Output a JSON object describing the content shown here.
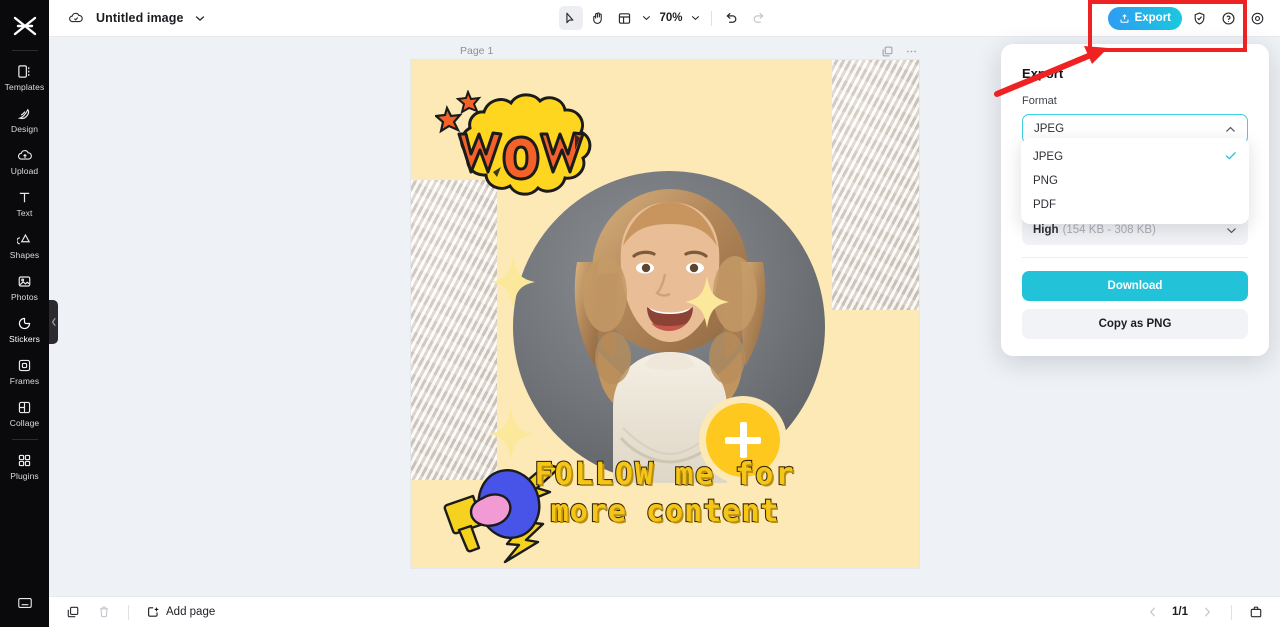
{
  "app": {
    "name": "CapCut-style design editor"
  },
  "sidebar": {
    "logo_icon": "capcut-logo-icon",
    "items": [
      {
        "id": "templates",
        "label": "Templates",
        "icon": "templates-icon"
      },
      {
        "id": "design",
        "label": "Design",
        "icon": "design-icon"
      },
      {
        "id": "upload",
        "label": "Upload",
        "icon": "upload-cloud-icon"
      },
      {
        "id": "text",
        "label": "Text",
        "icon": "text-icon"
      },
      {
        "id": "shapes",
        "label": "Shapes",
        "icon": "shapes-icon"
      },
      {
        "id": "photos",
        "label": "Photos",
        "icon": "photos-icon"
      },
      {
        "id": "stickers",
        "label": "Stickers",
        "icon": "stickers-icon"
      },
      {
        "id": "frames",
        "label": "Frames",
        "icon": "frames-icon"
      },
      {
        "id": "collage",
        "label": "Collage",
        "icon": "collage-icon"
      },
      {
        "id": "plugins",
        "label": "Plugins",
        "icon": "plugins-icon"
      }
    ],
    "bottom_icon": "workspace-icon",
    "collapse_handle_icon": "chevron-left-icon"
  },
  "topbar": {
    "cloud_icon": "cloud-saved-icon",
    "project_title": "Untitled image",
    "title_chevron_icon": "chevron-down-icon",
    "tools": [
      {
        "id": "select",
        "icon": "cursor-arrow-icon",
        "selected": true
      },
      {
        "id": "hand",
        "icon": "hand-icon",
        "selected": false
      },
      {
        "id": "layout",
        "icon": "layout-icon",
        "selected": false
      }
    ],
    "layout_chevron_icon": "chevron-down-icon",
    "zoom_level": "70%",
    "zoom_chevron_icon": "chevron-down-icon",
    "undo_icon": "undo-icon",
    "redo_icon": "redo-icon",
    "export_label": "Export",
    "export_icon": "export-upload-icon",
    "shield_icon": "shield-check-icon",
    "help_icon": "question-circle-icon",
    "settings_icon": "gear-icon"
  },
  "canvas": {
    "page_label": "Page 1",
    "duplicate_page_icon": "duplicate-icon",
    "more_icon": "more-horizontal-icon",
    "artwork": {
      "background_color": "#fce9b6",
      "wow_text": "WOW",
      "wow_bubble_color": "#ffd61f",
      "wow_letter_color": "#f4622a",
      "follow_line_1": "FOLLOW me for",
      "follow_line_2": "more content",
      "follow_text_color": "#f5c518",
      "plus_button_color": "#ffc81e",
      "plus_icon": "plus-icon",
      "megaphone_icon": "megaphone-icon",
      "lightning_icon": "lightning-bolt-icon",
      "sparkle_icon": "sparkle-icon",
      "circle_backdrop_color": "#73767a"
    }
  },
  "export_panel": {
    "title": "Export",
    "format_label": "Format",
    "format_value": "JPEG",
    "format_chevron_icon": "chevron-up-icon",
    "format_options": [
      {
        "label": "JPEG",
        "selected": true
      },
      {
        "label": "PNG",
        "selected": false
      },
      {
        "label": "PDF",
        "selected": false
      }
    ],
    "check_icon": "check-icon",
    "quality_value": "High",
    "quality_size": "(154 KB - 308 KB)",
    "quality_chevron_icon": "chevron-down-icon",
    "download_label": "Download",
    "copy_label": "Copy as PNG",
    "accent_color": "#22c3d8"
  },
  "annotation": {
    "highlight_color": "#ee2222",
    "arrow_icon": "arrow-pointer-annotation"
  },
  "bottombar": {
    "duplicate_icon": "duplicate-page-icon",
    "delete_icon": "trash-icon",
    "add_page_label": "Add page",
    "add_page_icon": "add-page-icon",
    "prev_icon": "chevron-left-icon",
    "next_icon": "chevron-right-icon",
    "page_indicator": "1/1",
    "panel_icon": "page-panel-icon"
  }
}
